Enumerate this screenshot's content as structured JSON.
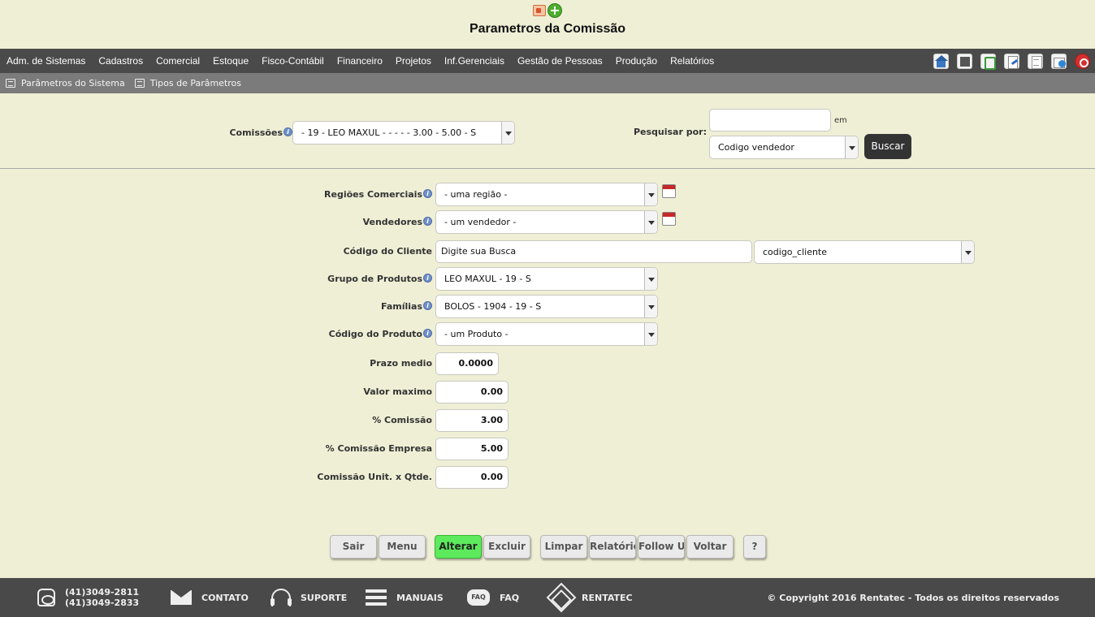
{
  "page_title": "Parametros da Comissão",
  "menu": [
    "Adm. de Sistemas",
    "Cadastros",
    "Comercial",
    "Estoque",
    "Fisco-Contábil",
    "Financeiro",
    "Projetos",
    "Inf.Gerenciais",
    "Gestão de Pessoas",
    "Produção",
    "Relatórios"
  ],
  "toolbar_icons": [
    "home-icon",
    "save-icon",
    "recycle-icon",
    "edit-document-icon",
    "document-icon",
    "world-document-icon",
    "exit-icon"
  ],
  "subnav": [
    "Parâmetros do Sistema",
    "Tipos de Parâmetros"
  ],
  "search": {
    "comissoes_label": "Comissões",
    "comissoes_value": "- 19 - LEO MAXUL - - - - - 3.00 - 5.00 - S",
    "pesquisar_label": "Pesquisar por:",
    "pesquisar_value": "",
    "em_label": "em",
    "field_select": "Codigo vendedor",
    "buscar_label": "Buscar"
  },
  "form": {
    "regioes_label": "Regiões Comerciais",
    "regioes_value": "- uma região -",
    "vendedores_label": "Vendedores",
    "vendedores_value": "- um vendedor -",
    "codigo_cliente_label": "Código do Cliente",
    "codigo_cliente_value": "Digite sua Busca",
    "codigo_cliente_field": "codigo_cliente",
    "grupo_label": "Grupo de Produtos",
    "grupo_value": "LEO MAXUL - 19 - S",
    "familias_label": "Famílias",
    "familias_value": "BOLOS - 1904 - 19 - S",
    "produto_label": "Código do Produto",
    "produto_value": "- um Produto -",
    "prazo_label": "Prazo medio",
    "prazo_value": "0.0000",
    "valor_label": "Valor maximo",
    "valor_value": "0.00",
    "comissao_label": "% Comissão",
    "comissao_value": "3.00",
    "comissao_empresa_label": "% Comissão Empresa",
    "comissao_empresa_value": "5.00",
    "comissao_unit_label": "Comissão Unit. x Qtde.",
    "comissao_unit_value": "0.00"
  },
  "buttons": {
    "sair": "Sair",
    "menu": "Menu",
    "alterar": "Alterar",
    "excluir": "Excluir",
    "limpar": "Limpar",
    "relatorio": "Relatório",
    "follow_up": "Follow Up",
    "voltar": "Voltar",
    "help": "?"
  },
  "footer": {
    "phone1": "(41)3049-2811",
    "phone2": "(41)3049-2833",
    "contato": "CONTATO",
    "suporte": "SUPORTE",
    "manuais": "MANUAIS",
    "faq": "FAQ",
    "faq_icon_text": "FAQ",
    "rentatec": "RENTATEC",
    "copyright": "© Copyright 2016 Rentatec - Todos os direitos reservados"
  },
  "colors": {
    "background": "#efefd6",
    "menubar": "#4a4a4a",
    "subbar": "#7b7b7b",
    "footer": "#494949",
    "alterar_button": "#5dea5d",
    "buscar_button": "#333333"
  }
}
